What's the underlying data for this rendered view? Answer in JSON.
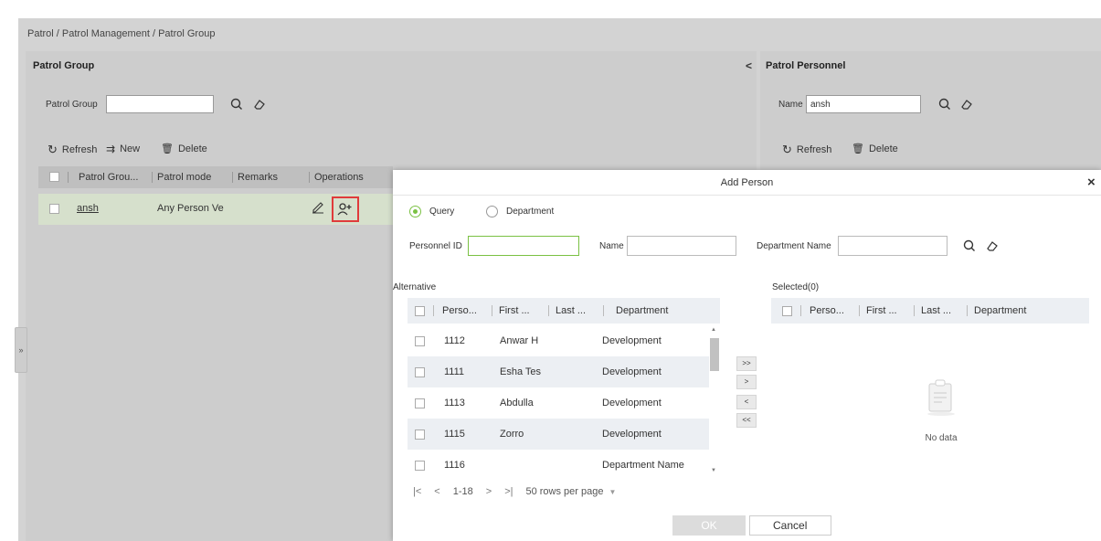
{
  "breadcrumb": "Patrol / Patrol Management / Patrol Group",
  "left_panel": {
    "title": "Patrol Group",
    "collapse_glyph": "<",
    "filter_label": "Patrol Group",
    "filter_value": "",
    "toolbar": {
      "refresh": "Refresh",
      "new": "New",
      "delete": "Delete"
    },
    "columns": [
      "Patrol Grou...",
      "Patrol mode",
      "Remarks",
      "Operations"
    ],
    "rows": [
      {
        "name": "ansh",
        "mode": "Any Person Ve"
      }
    ]
  },
  "right_panel": {
    "title": "Patrol Personnel",
    "filter_label": "Name",
    "filter_value": "ansh",
    "toolbar": {
      "refresh": "Refresh",
      "delete": "Delete"
    }
  },
  "expand_glyph": "»",
  "dialog": {
    "title": "Add Person",
    "close_glyph": "×",
    "radio_query": "Query",
    "radio_department": "Department",
    "personnel_id_label": "Personnel ID",
    "personnel_id_value": "",
    "name_label": "Name",
    "name_value": "",
    "dept_label": "Department Name",
    "dept_value": "",
    "alternative_label": "Alternative",
    "selected_label": "Selected(0)",
    "columns": [
      "Perso...",
      "First ...",
      "Last ...",
      "Department"
    ],
    "rows": [
      {
        "id": "1112",
        "first": "Anwar H⁠",
        "dept": "Development"
      },
      {
        "id": "1111",
        "first": "Esha Tes",
        "dept": "Development"
      },
      {
        "id": "1113",
        "first": "Abdulla",
        "dept": "Development"
      },
      {
        "id": "1115",
        "first": "Zorro",
        "dept": "Development"
      },
      {
        "id": "1116",
        "first": "",
        "dept": "Department Name"
      }
    ],
    "move_buttons": [
      ">>",
      ">",
      "<",
      "<<"
    ],
    "pagination": {
      "first": "|<",
      "prev": "<",
      "range": "1-18",
      "next": ">",
      "last": ">|",
      "rows_per_page": "50 rows per page"
    },
    "no_data": "No data",
    "ok": "OK",
    "cancel": "Cancel"
  },
  "colors": {
    "accent": "#7ac143",
    "highlight_box": "#e03b3b",
    "panel_bg": "#cdcdcd"
  }
}
